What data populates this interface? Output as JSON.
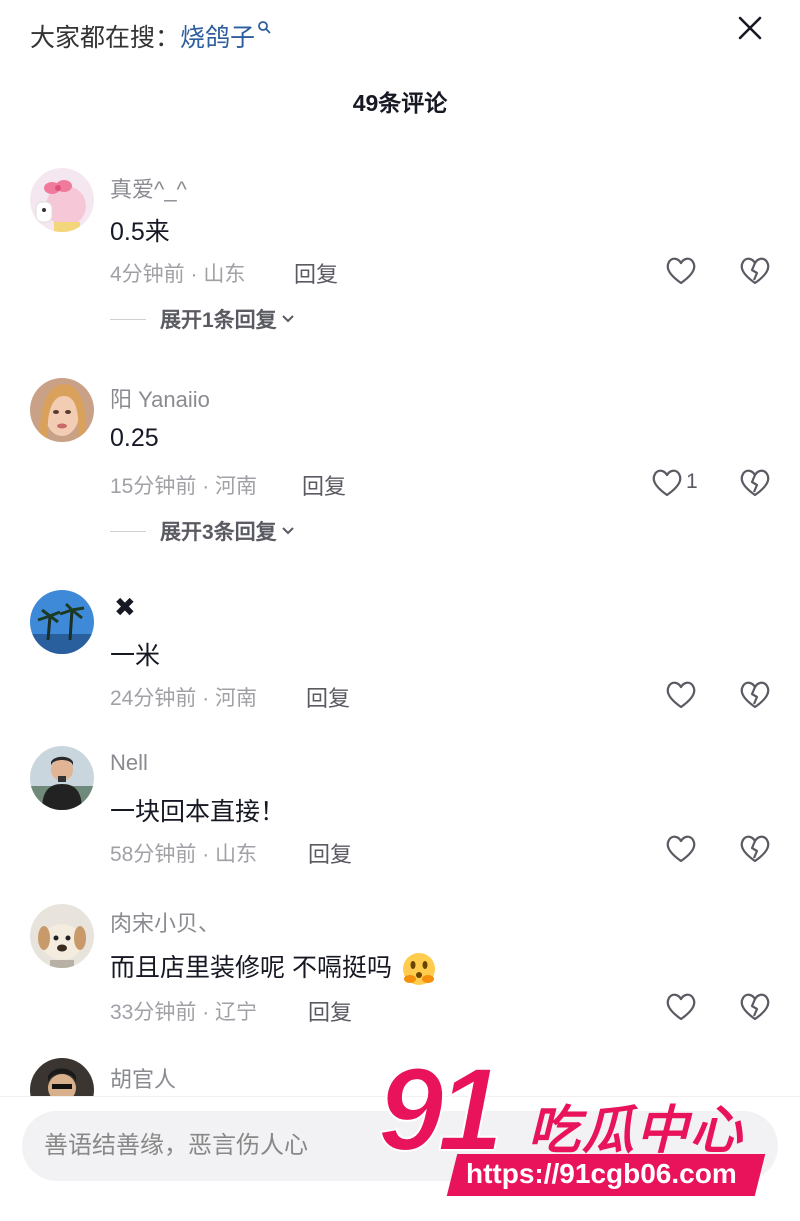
{
  "header": {
    "search_prefix": "大家都在搜：",
    "search_keyword": "烧鸽子",
    "comment_count": "49条评论"
  },
  "comments": [
    {
      "username": "真爱^_^",
      "text": "0.5来",
      "time_location": "4分钟前 · 山东",
      "reply_label": "回复",
      "like_count": "",
      "expand_label": "展开1条回复"
    },
    {
      "username": "阳  Yanaiio",
      "text": "0.25",
      "time_location": "15分钟前 · 河南",
      "reply_label": "回复",
      "like_count": "1",
      "expand_label": "展开3条回复"
    },
    {
      "username": "✖",
      "text": "一米",
      "time_location": "24分钟前 · 河南",
      "reply_label": "回复",
      "like_count": ""
    },
    {
      "username": "Nell",
      "text": "一块回本直接！",
      "time_location": "58分钟前 · 山东",
      "reply_label": "回复",
      "like_count": ""
    },
    {
      "username": "肉宋小贝、",
      "text": "而且店里装修呢  不嗝挺吗",
      "time_location": "33分钟前 · 辽宁",
      "reply_label": "回复",
      "like_count": ""
    },
    {
      "username": "胡官人"
    }
  ],
  "input": {
    "placeholder": "善语结善缘，恶言伤人心"
  },
  "watermark": {
    "number": "91",
    "title": "吃瓜中心",
    "url": "https://91cgb06.com"
  },
  "icons": {
    "close": "close-icon",
    "search": "search-icon",
    "like": "heart-outline-icon",
    "dislike": "broken-heart-icon",
    "expand": "chevron-down-icon",
    "emoji": "thinking-face-emoji"
  },
  "colors": {
    "text_primary": "#161823",
    "text_secondary": "#8a8b91",
    "link_blue": "#2d5f9e",
    "watermark_pink": "#e8135a",
    "input_bg": "#f2f2f4"
  }
}
